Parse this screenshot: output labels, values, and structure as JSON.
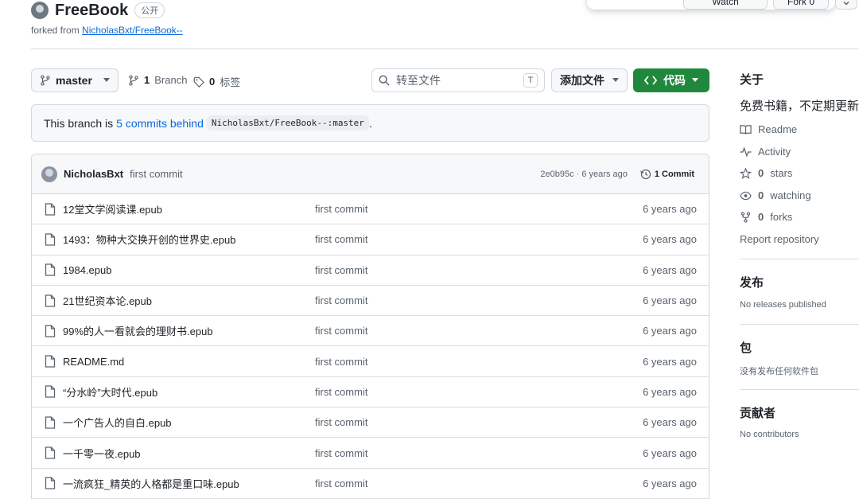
{
  "repo": {
    "name": "FreeBook",
    "visibility": "公开",
    "forked_prefix": "forked from",
    "forked_from": "NicholasBxt/FreeBook--"
  },
  "actions": {
    "watch_label": "Watch",
    "fork_label": "Fork",
    "fork_count": "0"
  },
  "toolbar": {
    "branch": "master",
    "branches_count": "1",
    "branches_label": "Branch",
    "tags_count": "0",
    "tags_label": "标签",
    "search_placeholder": "转至文件",
    "search_key": "T",
    "add_file": "添加文件",
    "code": "代码"
  },
  "banner": {
    "prefix": "This branch is",
    "link": "5 commits behind",
    "ref": "NicholasBxt/FreeBook--:master",
    "suffix": "."
  },
  "latest_commit": {
    "author": "NicholasBxt",
    "message": "first commit",
    "meta": "2e0b95c · 6 years ago",
    "count": "1 Commit"
  },
  "files": [
    {
      "name": "12堂文学阅读课.epub",
      "commit": "first commit",
      "date": "6 years ago"
    },
    {
      "name": "1493：物种大交换开创的世界史.epub",
      "commit": "first commit",
      "date": "6 years ago"
    },
    {
      "name": "1984.epub",
      "commit": "first commit",
      "date": "6 years ago"
    },
    {
      "name": "21世纪资本论.epub",
      "commit": "first commit",
      "date": "6 years ago"
    },
    {
      "name": "99%的人一看就会的理财书.epub",
      "commit": "first commit",
      "date": "6 years ago"
    },
    {
      "name": "README.md",
      "commit": "first commit",
      "date": "6 years ago"
    },
    {
      "name": "“分水岭”大时代.epub",
      "commit": "first commit",
      "date": "6 years ago"
    },
    {
      "name": "一个广告人的自白.epub",
      "commit": "first commit",
      "date": "6 years ago"
    },
    {
      "name": "一千零一夜.epub",
      "commit": "first commit",
      "date": "6 years ago"
    },
    {
      "name": "一流疯狂_精英的人格都是重口味.epub",
      "commit": "first commit",
      "date": "6 years ago"
    }
  ],
  "sidebar": {
    "about_title": "关于",
    "description": "免费书籍，不定期更新",
    "readme": "Readme",
    "activity": "Activity",
    "stars_count": "0",
    "stars_label": "stars",
    "watching_count": "0",
    "watching_label": "watching",
    "forks_count": "0",
    "forks_label": "forks",
    "report": "Report repository",
    "releases_title": "发布",
    "releases_empty": "No releases published",
    "packages_title": "包",
    "packages_empty": "没有发布任何软件包",
    "contributors_title": "贡献者",
    "contributors_empty": "No contributors"
  }
}
